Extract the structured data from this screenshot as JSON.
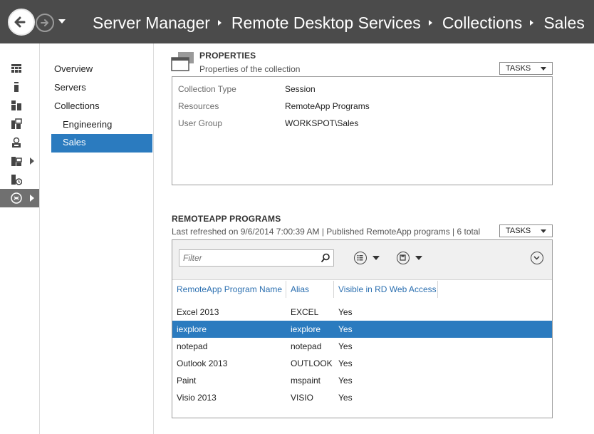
{
  "header": {
    "breadcrumb": [
      "Server Manager",
      "Remote Desktop Services",
      "Collections",
      "Sales"
    ]
  },
  "rail": {
    "items": [
      {
        "icon": "dashboard-icon"
      },
      {
        "icon": "local-server-icon"
      },
      {
        "icon": "all-servers-icon"
      },
      {
        "icon": "file-storage-icon"
      },
      {
        "icon": "rds-icon"
      },
      {
        "icon": "servers-group-icon"
      },
      {
        "icon": "server-role-icon"
      },
      {
        "icon": "remote-desktop-icon"
      }
    ]
  },
  "nav": {
    "items": [
      {
        "label": "Overview"
      },
      {
        "label": "Servers"
      },
      {
        "label": "Collections"
      },
      {
        "label": "Engineering"
      },
      {
        "label": "Sales"
      }
    ]
  },
  "properties": {
    "title": "PROPERTIES",
    "subtitle": "Properties of the collection",
    "tasks_label": "TASKS",
    "rows": [
      {
        "key": "Collection Type",
        "value": "Session"
      },
      {
        "key": "Resources",
        "value": "RemoteApp Programs"
      },
      {
        "key": "User Group",
        "value": "WORKSPOT\\Sales"
      }
    ]
  },
  "remoteapp": {
    "title": "REMOTEAPP PROGRAMS",
    "subtitle": "Last refreshed on 9/6/2014 7:00:39 AM | Published RemoteApp programs  | 6 total",
    "tasks_label": "TASKS",
    "filter_placeholder": "Filter",
    "columns": [
      "RemoteApp Program Name",
      "Alias",
      "Visible in RD Web Access"
    ],
    "rows": [
      {
        "name": "Excel 2013",
        "alias": "EXCEL",
        "visible": "Yes"
      },
      {
        "name": "iexplore",
        "alias": "iexplore",
        "visible": "Yes"
      },
      {
        "name": "notepad",
        "alias": "notepad",
        "visible": "Yes"
      },
      {
        "name": "Outlook 2013",
        "alias": "OUTLOOK",
        "visible": "Yes"
      },
      {
        "name": "Paint",
        "alias": "mspaint",
        "visible": "Yes"
      },
      {
        "name": "Visio 2013",
        "alias": "VISIO",
        "visible": "Yes"
      }
    ]
  }
}
